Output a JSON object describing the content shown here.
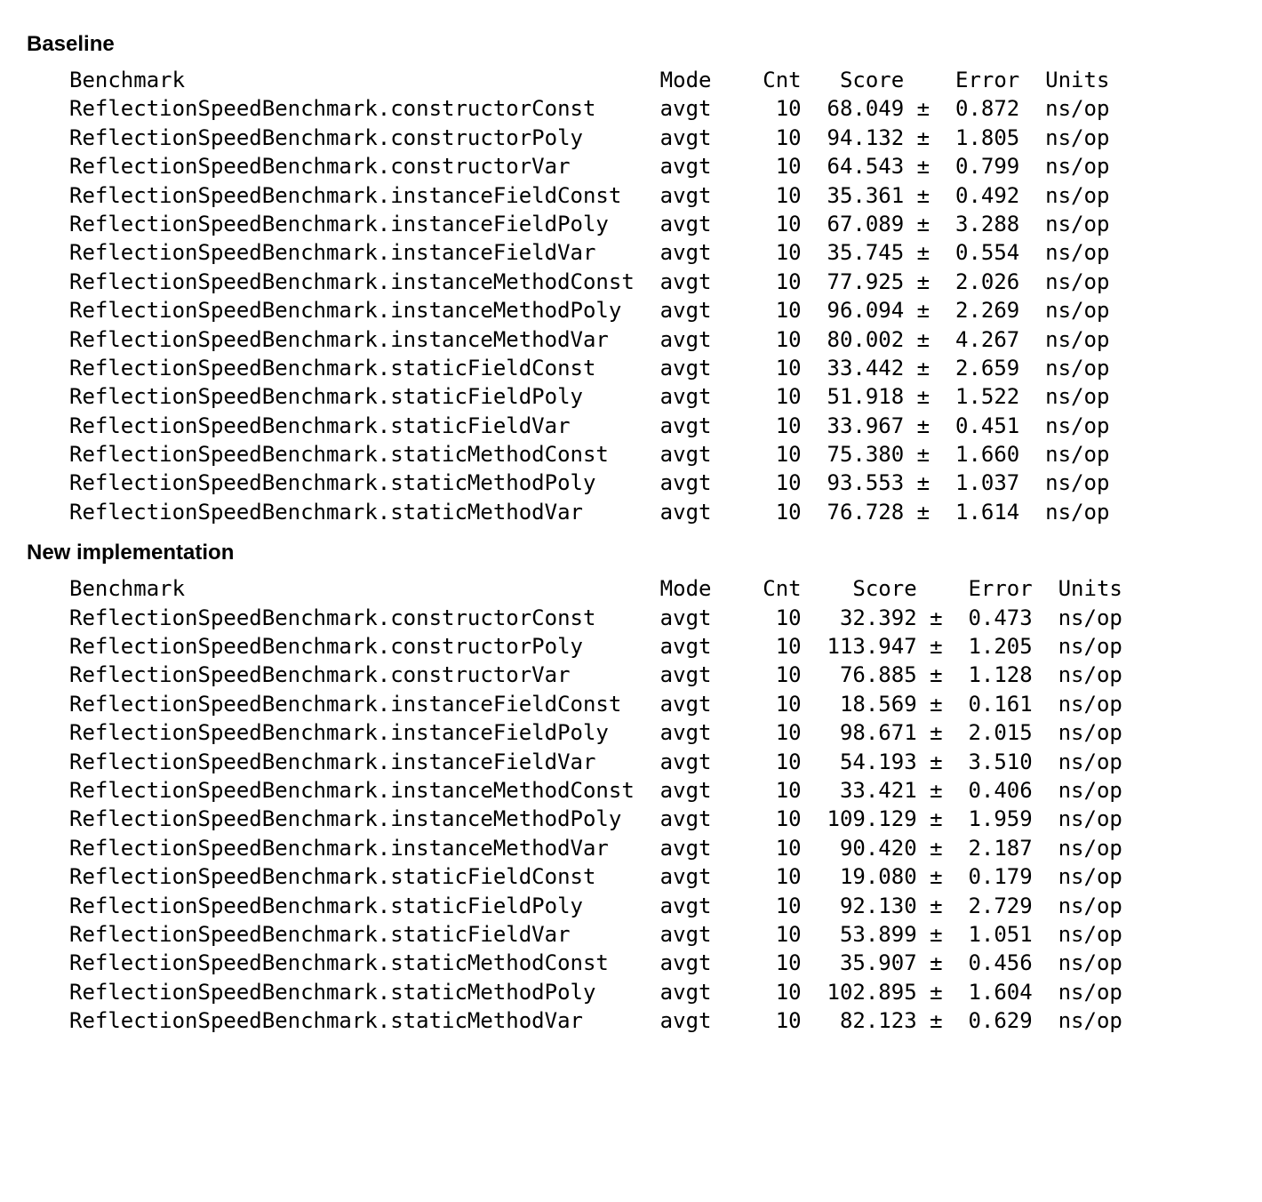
{
  "sections": [
    {
      "title": "Baseline",
      "header": {
        "benchmark": "Benchmark",
        "mode": "Mode",
        "cnt": "Cnt",
        "score": "Score",
        "error": "Error",
        "units": "Units"
      },
      "colWidths": {
        "name": 46,
        "mode": 6,
        "cnt": 5,
        "score": 8,
        "err": 8,
        "units": 7
      },
      "rows": [
        {
          "name": "ReflectionSpeedBenchmark.constructorConst",
          "mode": "avgt",
          "cnt": "10",
          "score": "68.049",
          "pm": "±",
          "err": "0.872",
          "units": "ns/op"
        },
        {
          "name": "ReflectionSpeedBenchmark.constructorPoly",
          "mode": "avgt",
          "cnt": "10",
          "score": "94.132",
          "pm": "±",
          "err": "1.805",
          "units": "ns/op"
        },
        {
          "name": "ReflectionSpeedBenchmark.constructorVar",
          "mode": "avgt",
          "cnt": "10",
          "score": "64.543",
          "pm": "±",
          "err": "0.799",
          "units": "ns/op"
        },
        {
          "name": "ReflectionSpeedBenchmark.instanceFieldConst",
          "mode": "avgt",
          "cnt": "10",
          "score": "35.361",
          "pm": "±",
          "err": "0.492",
          "units": "ns/op"
        },
        {
          "name": "ReflectionSpeedBenchmark.instanceFieldPoly",
          "mode": "avgt",
          "cnt": "10",
          "score": "67.089",
          "pm": "±",
          "err": "3.288",
          "units": "ns/op"
        },
        {
          "name": "ReflectionSpeedBenchmark.instanceFieldVar",
          "mode": "avgt",
          "cnt": "10",
          "score": "35.745",
          "pm": "±",
          "err": "0.554",
          "units": "ns/op"
        },
        {
          "name": "ReflectionSpeedBenchmark.instanceMethodConst",
          "mode": "avgt",
          "cnt": "10",
          "score": "77.925",
          "pm": "±",
          "err": "2.026",
          "units": "ns/op"
        },
        {
          "name": "ReflectionSpeedBenchmark.instanceMethodPoly",
          "mode": "avgt",
          "cnt": "10",
          "score": "96.094",
          "pm": "±",
          "err": "2.269",
          "units": "ns/op"
        },
        {
          "name": "ReflectionSpeedBenchmark.instanceMethodVar",
          "mode": "avgt",
          "cnt": "10",
          "score": "80.002",
          "pm": "±",
          "err": "4.267",
          "units": "ns/op"
        },
        {
          "name": "ReflectionSpeedBenchmark.staticFieldConst",
          "mode": "avgt",
          "cnt": "10",
          "score": "33.442",
          "pm": "±",
          "err": "2.659",
          "units": "ns/op"
        },
        {
          "name": "ReflectionSpeedBenchmark.staticFieldPoly",
          "mode": "avgt",
          "cnt": "10",
          "score": "51.918",
          "pm": "±",
          "err": "1.522",
          "units": "ns/op"
        },
        {
          "name": "ReflectionSpeedBenchmark.staticFieldVar",
          "mode": "avgt",
          "cnt": "10",
          "score": "33.967",
          "pm": "±",
          "err": "0.451",
          "units": "ns/op"
        },
        {
          "name": "ReflectionSpeedBenchmark.staticMethodConst",
          "mode": "avgt",
          "cnt": "10",
          "score": "75.380",
          "pm": "±",
          "err": "1.660",
          "units": "ns/op"
        },
        {
          "name": "ReflectionSpeedBenchmark.staticMethodPoly",
          "mode": "avgt",
          "cnt": "10",
          "score": "93.553",
          "pm": "±",
          "err": "1.037",
          "units": "ns/op"
        },
        {
          "name": "ReflectionSpeedBenchmark.staticMethodVar",
          "mode": "avgt",
          "cnt": "10",
          "score": "76.728",
          "pm": "±",
          "err": "1.614",
          "units": "ns/op"
        }
      ]
    },
    {
      "title": "New implementation",
      "header": {
        "benchmark": "Benchmark",
        "mode": "Mode",
        "cnt": "Cnt",
        "score": "Score",
        "error": "Error",
        "units": "Units"
      },
      "colWidths": {
        "name": 46,
        "mode": 6,
        "cnt": 5,
        "score": 9,
        "err": 8,
        "units": 7
      },
      "rows": [
        {
          "name": "ReflectionSpeedBenchmark.constructorConst",
          "mode": "avgt",
          "cnt": "10",
          "score": "32.392",
          "pm": "±",
          "err": "0.473",
          "units": "ns/op"
        },
        {
          "name": "ReflectionSpeedBenchmark.constructorPoly",
          "mode": "avgt",
          "cnt": "10",
          "score": "113.947",
          "pm": "±",
          "err": "1.205",
          "units": "ns/op"
        },
        {
          "name": "ReflectionSpeedBenchmark.constructorVar",
          "mode": "avgt",
          "cnt": "10",
          "score": "76.885",
          "pm": "±",
          "err": "1.128",
          "units": "ns/op"
        },
        {
          "name": "ReflectionSpeedBenchmark.instanceFieldConst",
          "mode": "avgt",
          "cnt": "10",
          "score": "18.569",
          "pm": "±",
          "err": "0.161",
          "units": "ns/op"
        },
        {
          "name": "ReflectionSpeedBenchmark.instanceFieldPoly",
          "mode": "avgt",
          "cnt": "10",
          "score": "98.671",
          "pm": "±",
          "err": "2.015",
          "units": "ns/op"
        },
        {
          "name": "ReflectionSpeedBenchmark.instanceFieldVar",
          "mode": "avgt",
          "cnt": "10",
          "score": "54.193",
          "pm": "±",
          "err": "3.510",
          "units": "ns/op"
        },
        {
          "name": "ReflectionSpeedBenchmark.instanceMethodConst",
          "mode": "avgt",
          "cnt": "10",
          "score": "33.421",
          "pm": "±",
          "err": "0.406",
          "units": "ns/op"
        },
        {
          "name": "ReflectionSpeedBenchmark.instanceMethodPoly",
          "mode": "avgt",
          "cnt": "10",
          "score": "109.129",
          "pm": "±",
          "err": "1.959",
          "units": "ns/op"
        },
        {
          "name": "ReflectionSpeedBenchmark.instanceMethodVar",
          "mode": "avgt",
          "cnt": "10",
          "score": "90.420",
          "pm": "±",
          "err": "2.187",
          "units": "ns/op"
        },
        {
          "name": "ReflectionSpeedBenchmark.staticFieldConst",
          "mode": "avgt",
          "cnt": "10",
          "score": "19.080",
          "pm": "±",
          "err": "0.179",
          "units": "ns/op"
        },
        {
          "name": "ReflectionSpeedBenchmark.staticFieldPoly",
          "mode": "avgt",
          "cnt": "10",
          "score": "92.130",
          "pm": "±",
          "err": "2.729",
          "units": "ns/op"
        },
        {
          "name": "ReflectionSpeedBenchmark.staticFieldVar",
          "mode": "avgt",
          "cnt": "10",
          "score": "53.899",
          "pm": "±",
          "err": "1.051",
          "units": "ns/op"
        },
        {
          "name": "ReflectionSpeedBenchmark.staticMethodConst",
          "mode": "avgt",
          "cnt": "10",
          "score": "35.907",
          "pm": "±",
          "err": "0.456",
          "units": "ns/op"
        },
        {
          "name": "ReflectionSpeedBenchmark.staticMethodPoly",
          "mode": "avgt",
          "cnt": "10",
          "score": "102.895",
          "pm": "±",
          "err": "1.604",
          "units": "ns/op"
        },
        {
          "name": "ReflectionSpeedBenchmark.staticMethodVar",
          "mode": "avgt",
          "cnt": "10",
          "score": "82.123",
          "pm": "±",
          "err": "0.629",
          "units": "ns/op"
        }
      ]
    }
  ]
}
